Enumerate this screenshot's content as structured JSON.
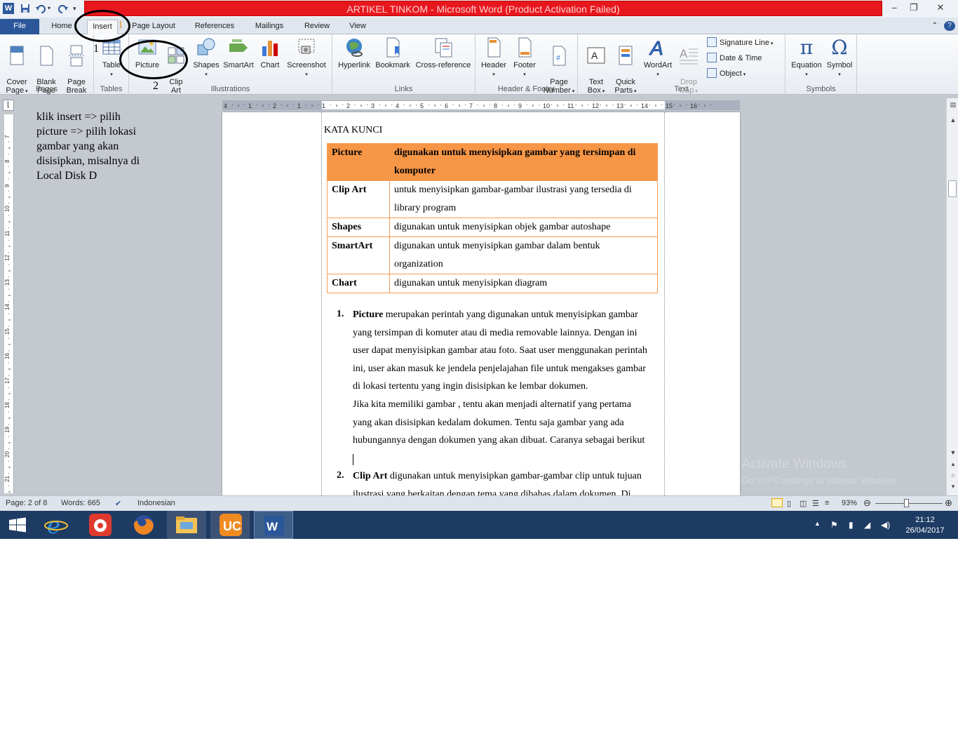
{
  "window": {
    "title": "ARTIKEL TINKOM  -  Microsoft Word (Product Activation Failed)",
    "app_icon_label": "W"
  },
  "ribbon_tabs": [
    "File",
    "Home",
    "Insert",
    "Page Layout",
    "References",
    "Mailings",
    "Review",
    "View"
  ],
  "ribbon": {
    "pages": {
      "label": "Pages",
      "cover_page": "Cover\nPage",
      "blank_page": "Blank\nPage",
      "page_break": "Page\nBreak"
    },
    "tables": {
      "label": "Tables",
      "table": "Table"
    },
    "illustrations": {
      "label": "Illustrations",
      "picture": "Picture",
      "clip_art": "Clip\nArt",
      "shapes": "Shapes",
      "smartart": "SmartArt",
      "chart": "Chart",
      "screenshot": "Screenshot"
    },
    "links": {
      "label": "Links",
      "hyperlink": "Hyperlink",
      "bookmark": "Bookmark",
      "cross_reference": "Cross-reference"
    },
    "header_footer": {
      "label": "Header & Footer",
      "header": "Header",
      "footer": "Footer",
      "page_number": "Page\nNumber"
    },
    "text": {
      "label": "Text",
      "text_box": "Text\nBox",
      "quick_parts": "Quick\nParts",
      "wordart": "WordArt",
      "drop_cap": "Drop\nCap",
      "signature_line": "Signature Line",
      "date_time": "Date & Time",
      "object": "Object"
    },
    "symbols": {
      "label": "Symbols",
      "equation": "Equation",
      "symbol": "Symbol"
    }
  },
  "annotations": {
    "step1": "1",
    "step2": "2"
  },
  "side_note": "klik insert => pilih picture => pilih lokasi gambar yang akan disisipkan, misalnya di Local Disk D",
  "ruler_h": [
    "4",
    "1",
    "2",
    "1",
    "1",
    "2",
    "3",
    "4",
    "5",
    "6",
    "7",
    "8",
    "9",
    "10",
    "11",
    "12",
    "13",
    "14",
    "15",
    "16"
  ],
  "ruler_v": [
    "7",
    "8",
    "9",
    "10",
    "11",
    "12",
    "13",
    "14",
    "15",
    "16",
    "17",
    "18",
    "19",
    "20",
    "21"
  ],
  "document": {
    "heading": "KATA KUNCI",
    "table": [
      {
        "term": "Picture",
        "desc1": "digunakan untuk menyisipkan gambar yang tersimpan di",
        "desc2": "komputer"
      },
      {
        "term": "Clip Art",
        "desc1": "untuk menyisipkan gambar-gambar ilustrasi yang tersedia di",
        "desc2": "library program"
      },
      {
        "term": "Shapes",
        "desc1": "digunakan untuk menyisipkan objek gambar autoshape",
        "desc2": ""
      },
      {
        "term": "SmartArt",
        "desc1": "digunakan untuk menyisipkan gambar dalam bentuk",
        "desc2": "organization"
      },
      {
        "term": "Chart",
        "desc1": "digunakan untuk menyisipkan diagram",
        "desc2": ""
      }
    ],
    "item1": {
      "number": "1.",
      "term": "Picture",
      "lines": [
        " merupakan perintah yang digunakan untuk menyisipkan gambar",
        "yang tersimpan di komuter atau di media removable lainnya. Dengan ini",
        "user dapat menyisipkan gambar atau foto. Saat user menggunakan perintah",
        "ini, user akan masuk ke jendela penjelajahan file untuk mengakses gambar",
        "di lokasi tertentu yang ingin disisipkan ke lembar dokumen.",
        "Jika kita memiliki gambar , tentu akan menjadi alternatif yang pertama",
        "yang akan disisipkan kedalam dokumen. Tentu saja gambar yang ada",
        "hubungannya dengan dokumen yang akan dibuat. Caranya sebagai berikut"
      ]
    },
    "item2": {
      "number": "2.",
      "term": "Clip Art",
      "lines": [
        " digunakan untuk menyisipkan gambar-gambar clip untuk tujuan",
        "ilustrasi yang berkaitan dengan tema yang dibahas dalam dokumen. Di"
      ]
    }
  },
  "watermark": {
    "line1": "Activate Windows",
    "line2": "Go to PC settings to activate Windows."
  },
  "status": {
    "page": "Page: 2 of 8",
    "words": "Words: 665",
    "language": "Indonesian",
    "zoom": "93%",
    "zoom_level": 0.47
  },
  "taskbar": {
    "time": "21:12",
    "date": "26/04/2017"
  },
  "colors": {
    "title_bar": "#e8171e",
    "file_tab": "#2b579a",
    "table_header": "#f79646",
    "table_border": "#f59d56",
    "taskbar": "#1d3b63"
  }
}
